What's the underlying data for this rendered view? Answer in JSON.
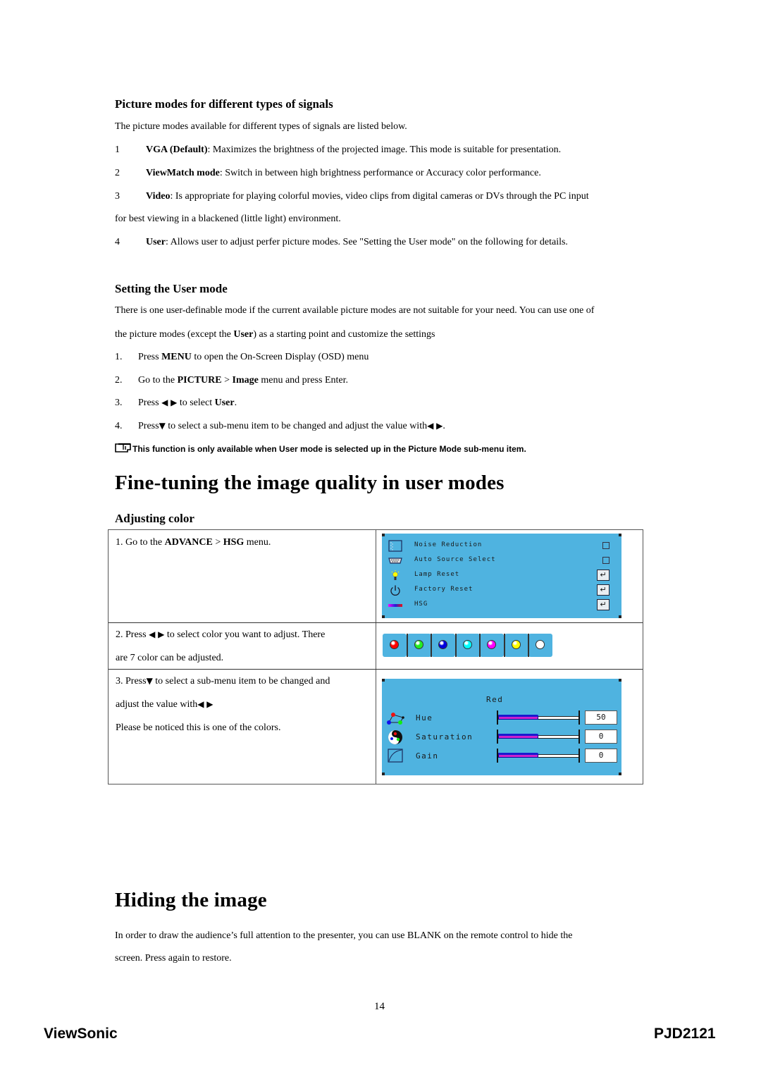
{
  "section1": {
    "heading": "Picture modes for different types of signals",
    "intro": "The picture modes available for different types of signals are listed below.",
    "items": [
      {
        "num": "1",
        "bold": "VGA (Default)",
        "text": ": Maximizes the brightness of the projected image. This mode is suitable for presentation."
      },
      {
        "num": "2",
        "bold": "ViewMatch mode",
        "text": ": Switch in between high brightness performance or Accuracy color performance."
      },
      {
        "num": "3",
        "bold": "Video",
        "text": ": Is appropriate for playing colorful movies, video clips from digital cameras or DVs through the PC input",
        "cont": "for best viewing in a blackened (little light) environment."
      },
      {
        "num": "4",
        "bold": "User",
        "text": ": Allows user to adjust perfer picture modes. See \"Setting the User mode\" on the following for details."
      }
    ]
  },
  "section2": {
    "heading": "Setting the User mode",
    "intro_line1": "There is one user-definable mode if the current available picture modes are not suitable for your need. You can use one of",
    "intro_line2_a": "the picture modes (except the ",
    "intro_line2_b": "User",
    "intro_line2_c": ") as a starting point and customize the settings",
    "steps": [
      {
        "num": "1.",
        "a": "Press ",
        "b": "MENU",
        "c": " to open the On-Screen Display (OSD) menu"
      },
      {
        "num": "2.",
        "a": "Go to the ",
        "b": "PICTURE",
        "c": " > ",
        "d": "Image",
        "e": " menu and press Enter."
      },
      {
        "num": "3.",
        "a": "Press ",
        "arrows": "◀ ▶",
        "c": " to select ",
        "b": "User",
        "e": "."
      },
      {
        "num": "4.",
        "a": "Press",
        "down": "▼",
        "c": " to select a sub-menu item to be changed and adjust the value with",
        "arrows": "◀ ▶",
        "e": "."
      }
    ],
    "note": "This function is only available when User mode is selected up in the Picture Mode sub-menu item."
  },
  "section3": {
    "heading": "Fine-tuning the image quality in user modes",
    "subheading": "Adjusting color",
    "rows": [
      {
        "a": "1. Go to the ",
        "b1": "ADVANCE",
        "m": " > ",
        "b2": "HSG",
        "c": " menu."
      },
      {
        "a": "2. Press ",
        "arrows": "◀ ▶",
        "c": " to select color you want to adjust. There",
        "line2": "are 7 color can be adjusted."
      },
      {
        "a": "3. Press",
        "down": "▼",
        "c": " to select a sub-menu item to be changed and",
        "line2": "adjust the value with",
        "arrows": "◀ ▶",
        "line3": "Please be noticed this is one of the colors."
      }
    ],
    "osd_menu": {
      "items": [
        {
          "label": "Noise Reduction",
          "icon": "noise-reduction-icon",
          "control": "checkbox"
        },
        {
          "label": "Auto Source Select",
          "icon": "vga-connector-icon",
          "control": "checkbox"
        },
        {
          "label": "Lamp Reset",
          "icon": "lamp-icon",
          "control": "enter"
        },
        {
          "label": "Factory Reset",
          "icon": "power-icon",
          "control": "enter"
        },
        {
          "label": "HSG",
          "icon": "color-bar-icon",
          "control": "enter"
        }
      ],
      "enter_glyph": "↵"
    },
    "color_swatches": [
      {
        "name": "red",
        "color": "#ff0000"
      },
      {
        "name": "green",
        "color": "#22ee22"
      },
      {
        "name": "blue",
        "color": "#0000dd"
      },
      {
        "name": "cyan",
        "color": "#00ffff"
      },
      {
        "name": "magenta",
        "color": "#ff00ff"
      },
      {
        "name": "yellow",
        "color": "#ffff00"
      },
      {
        "name": "white",
        "color": "#ffffff"
      }
    ],
    "hsg_panel": {
      "title": "Red",
      "rows": [
        {
          "label": "Hue",
          "value": "50",
          "fill": 0.5,
          "icon": "hue-triangle-icon"
        },
        {
          "label": "Saturation",
          "value": "0",
          "fill": 0.5,
          "icon": "saturation-yin-yang-icon"
        },
        {
          "label": "Gain",
          "value": "0",
          "fill": 0.5,
          "icon": "gain-curve-icon"
        }
      ]
    }
  },
  "section4": {
    "heading": "Hiding the image",
    "line1": "In order to draw the audience’s full attention to the presenter, you can use BLANK on the remote control to hide the",
    "line2": "screen. Press again to restore."
  },
  "footer": {
    "page_number": "14",
    "brand": "ViewSonic",
    "model": "PJD2121"
  },
  "colors": {
    "osd_background": "#4fb3e0"
  }
}
